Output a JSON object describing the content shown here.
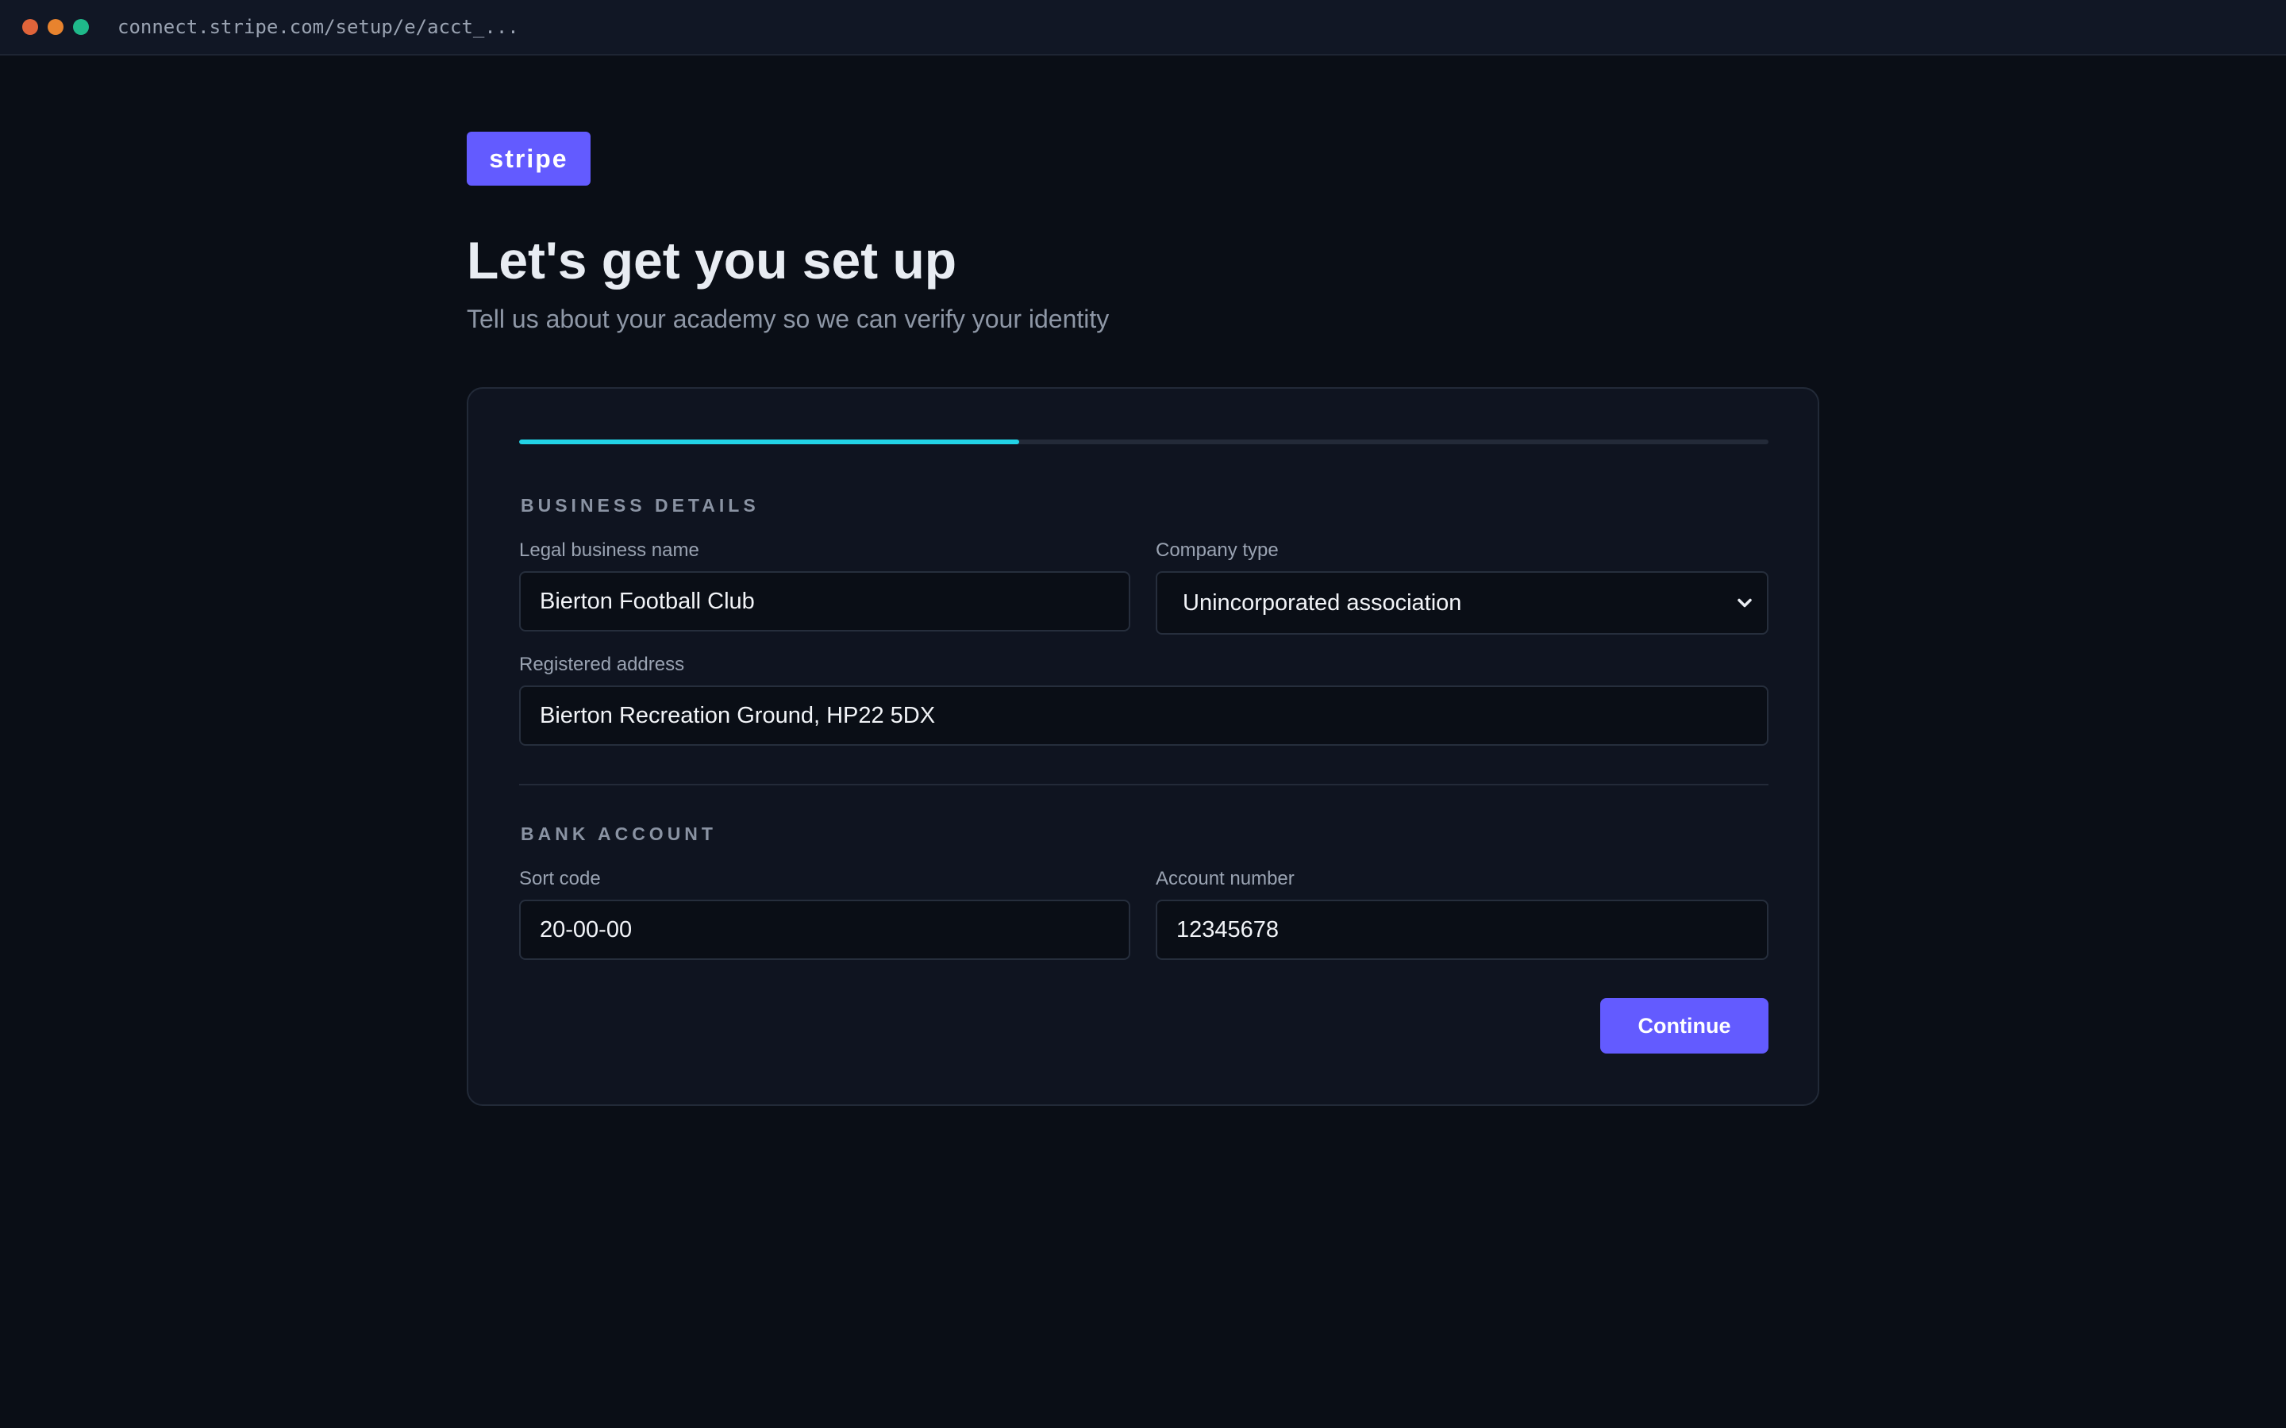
{
  "browser": {
    "url": "connect.stripe.com/setup/e/acct_...",
    "traffic_lights": [
      "#e0643a",
      "#e8832e",
      "#1fb98a"
    ]
  },
  "brand": {
    "logo_text": "stripe",
    "accent": "#635bff"
  },
  "header": {
    "title": "Let's get you set up",
    "subtitle": "Tell us about your academy so we can verify your identity"
  },
  "progress": {
    "fraction": 0.4,
    "color": "#22d3e6"
  },
  "business": {
    "section_title": "BUSINESS DETAILS",
    "legal_name_label": "Legal business name",
    "legal_name_value": "Bierton Football Club",
    "company_type_label": "Company type",
    "company_type_value": "Unincorporated association",
    "address_label": "Registered address",
    "address_value": "Bierton Recreation Ground, HP22 5DX"
  },
  "bank": {
    "section_title": "BANK ACCOUNT",
    "sort_code_label": "Sort code",
    "sort_code_value": "20-00-00",
    "account_number_label": "Account number",
    "account_number_value": "12345678"
  },
  "actions": {
    "continue_label": "Continue"
  }
}
